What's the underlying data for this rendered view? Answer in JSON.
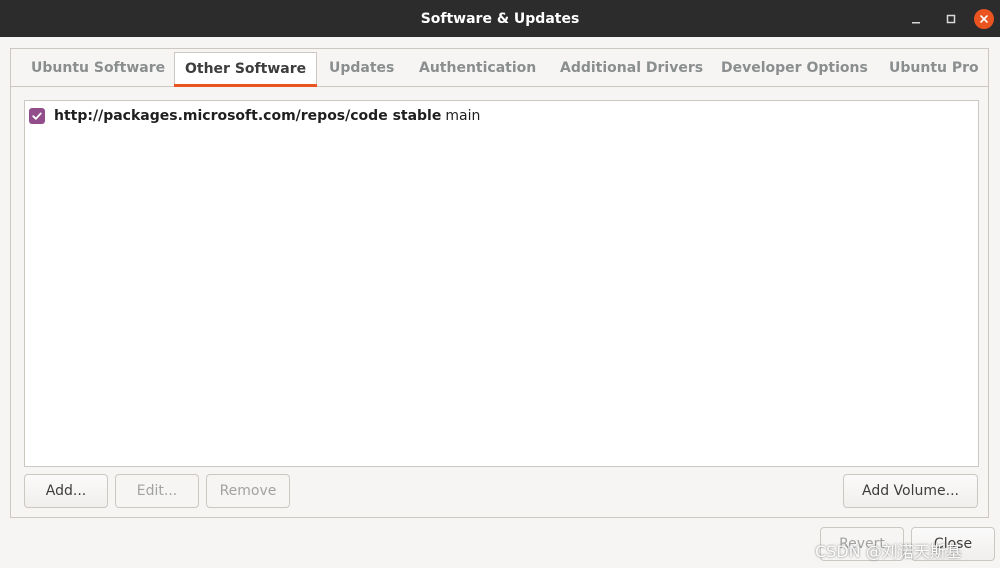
{
  "window": {
    "title": "Software & Updates",
    "close_color": "#e95420"
  },
  "tabs": [
    {
      "label": "Ubuntu Software",
      "active": false
    },
    {
      "label": "Other Software",
      "active": true
    },
    {
      "label": "Updates",
      "active": false
    },
    {
      "label": "Authentication",
      "active": false
    },
    {
      "label": "Additional Drivers",
      "active": false
    },
    {
      "label": "Developer Options",
      "active": false
    },
    {
      "label": "Ubuntu Pro",
      "active": false
    }
  ],
  "sources": [
    {
      "checked": true,
      "source": "http://packages.microsoft.com/repos/code stable",
      "component": "main"
    }
  ],
  "buttons": {
    "add": "Add...",
    "edit": "Edit...",
    "remove": "Remove",
    "add_volume": "Add Volume...",
    "revert": "Revert",
    "close": "Close"
  },
  "watermark": "CSDN @刘诺天斯基",
  "colors": {
    "accent": "#e95420",
    "checkbox": "#924d8b",
    "titlebar": "#2c2c2c"
  }
}
